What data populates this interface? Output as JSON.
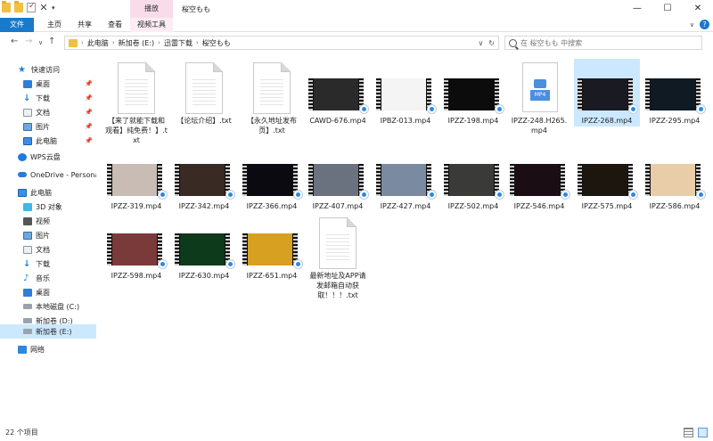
{
  "titlebar": {
    "ctx_tab": "播放",
    "title": "桜空もも",
    "min_glyph": "—",
    "max_glyph": "☐",
    "close_glyph": "✕"
  },
  "ribbon": {
    "file": "文件",
    "home": "主页",
    "share": "共享",
    "view": "查看",
    "video_tools": "视频工具"
  },
  "address": {
    "crumbs": [
      "此电脑",
      "新加卷 (E:)",
      "迅雷下载",
      "桜空もも"
    ],
    "search_placeholder": "在 桜空もも 中搜索"
  },
  "nav": {
    "items": [
      {
        "label": "快速访问",
        "icon": "star-icon"
      },
      {
        "label": "桌面",
        "icon": "desktop-icon",
        "pinned": true
      },
      {
        "label": "下载",
        "icon": "download-icon",
        "pinned": true
      },
      {
        "label": "文档",
        "icon": "documents-icon",
        "pinned": true
      },
      {
        "label": "图片",
        "icon": "pictures-icon",
        "pinned": true
      },
      {
        "label": "此电脑",
        "icon": "pc-icon",
        "pinned": true
      },
      {
        "label": "WPS云盘",
        "icon": "cloud-icon"
      },
      {
        "label": "OneDrive - Persona",
        "icon": "onedrive-icon"
      },
      {
        "label": "此电脑",
        "icon": "pc-icon"
      },
      {
        "label": "3D 对象",
        "icon": "cube-icon"
      },
      {
        "label": "视频",
        "icon": "video-icon"
      },
      {
        "label": "图片",
        "icon": "pictures-icon"
      },
      {
        "label": "文档",
        "icon": "documents-icon"
      },
      {
        "label": "下载",
        "icon": "download-icon"
      },
      {
        "label": "音乐",
        "icon": "music-icon"
      },
      {
        "label": "桌面",
        "icon": "desktop-icon"
      },
      {
        "label": "本地磁盘 (C:)",
        "icon": "drive-icon"
      },
      {
        "label": "新加卷 (D:)",
        "icon": "drive-icon"
      },
      {
        "label": "新加卷 (E:)",
        "icon": "drive-icon"
      },
      {
        "label": "网络",
        "icon": "network-icon"
      }
    ]
  },
  "files": [
    {
      "name": "【来了就能下载和观看】纯免费！】.txt",
      "type": "txt"
    },
    {
      "name": "【论坛介绍】.txt",
      "type": "txt"
    },
    {
      "name": "【永久地址发布页】.txt",
      "type": "txt"
    },
    {
      "name": "CAWD-676.mp4",
      "type": "video",
      "color": "#2a2a2a"
    },
    {
      "name": "IPBZ-013.mp4",
      "type": "video",
      "color": "#f4f4f4"
    },
    {
      "name": "IPZZ-198.mp4",
      "type": "video",
      "color": "#0c0c0c"
    },
    {
      "name": "IPZZ-248.H265.mp4",
      "type": "mp4doc"
    },
    {
      "name": "IPZZ-268.mp4",
      "type": "video",
      "color": "#1a1a22"
    },
    {
      "name": "IPZZ-295.mp4",
      "type": "video",
      "color": "#0f1a22"
    },
    {
      "name": "IPZZ-319.mp4",
      "type": "video",
      "color": "#c8bcb4"
    },
    {
      "name": "IPZZ-342.mp4",
      "type": "video",
      "color": "#3a2a24"
    },
    {
      "name": "IPZZ-366.mp4",
      "type": "video",
      "color": "#0a0a10"
    },
    {
      "name": "IPZZ-407.mp4",
      "type": "video",
      "color": "#6a7280"
    },
    {
      "name": "IPZZ-427.mp4",
      "type": "video",
      "color": "#7a8aa0"
    },
    {
      "name": "IPZZ-502.mp4",
      "type": "video",
      "color": "#3a3a38"
    },
    {
      "name": "IPZZ-546.mp4",
      "type": "video",
      "color": "#1a0e14"
    },
    {
      "name": "IPZZ-575.mp4",
      "type": "video",
      "color": "#1c160e"
    },
    {
      "name": "IPZZ-586.mp4",
      "type": "video",
      "color": "#e8cda8"
    },
    {
      "name": "IPZZ-598.mp4",
      "type": "video",
      "color": "#7a3a3a"
    },
    {
      "name": "IPZZ-630.mp4",
      "type": "video",
      "color": "#0c3a1a"
    },
    {
      "name": "IPZZ-651.mp4",
      "type": "video",
      "color": "#d8a020"
    },
    {
      "name": "最新地址及APP请发邮箱自动获取！！！.txt",
      "type": "txt"
    }
  ],
  "status": {
    "item_count": "22 个项目"
  }
}
